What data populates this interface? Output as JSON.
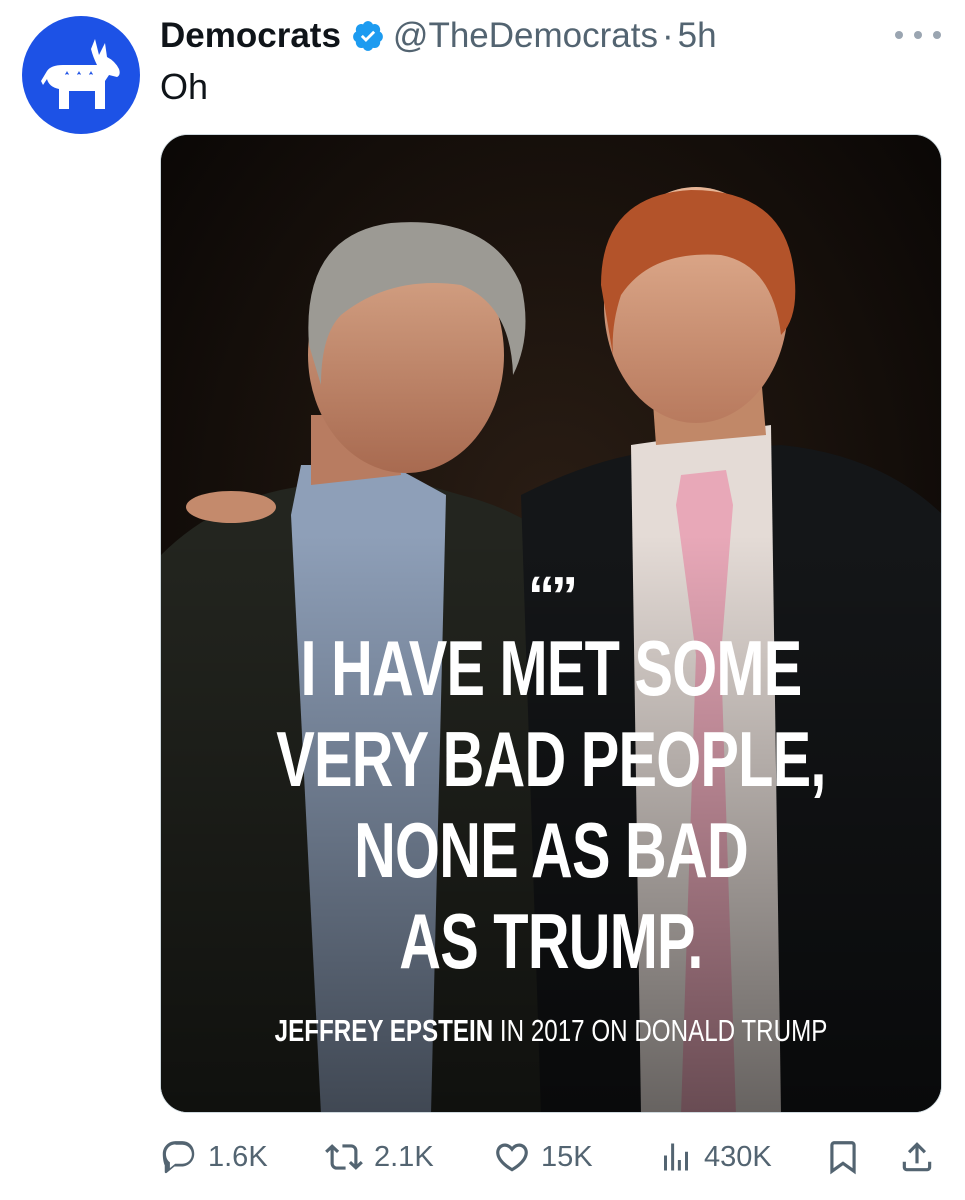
{
  "account": {
    "display_name": "Democrats",
    "handle": "@TheDemocrats",
    "separator": "·",
    "time": "5h",
    "verified_color": "#1d9bf0",
    "avatar_color": "#1d52e6"
  },
  "tweet": {
    "text": "Oh"
  },
  "media": {
    "quote_mark": "“”",
    "quote_lines": [
      "I HAVE MET SOME",
      "VERY BAD PEOPLE,",
      "NONE AS BAD",
      "AS TRUMP."
    ],
    "attribution_name": "JEFFREY EPSTEIN",
    "attribution_rest": " IN 2017 ON DONALD TRUMP"
  },
  "actions": {
    "replies": "1.6K",
    "reposts": "2.1K",
    "likes": "15K",
    "views": "430K"
  },
  "icons": {
    "reply": "reply-icon",
    "repost": "repost-icon",
    "like": "heart-icon",
    "views": "views-chart-icon",
    "bookmark": "bookmark-icon",
    "share": "share-icon",
    "more": "more-options-icon"
  }
}
